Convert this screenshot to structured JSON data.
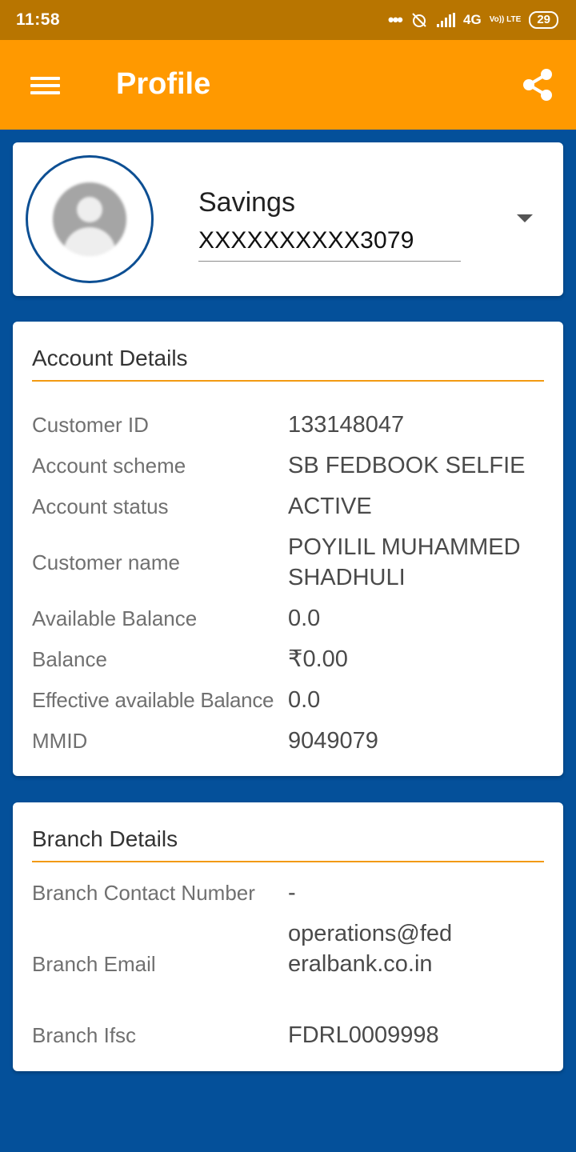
{
  "status_bar": {
    "time": "11:58",
    "network": "4G",
    "volte": "Vo)) LTE",
    "battery": "29"
  },
  "app_bar": {
    "title": "Profile",
    "menu_icon": "hamburger-menu-icon",
    "share_icon": "share-icon"
  },
  "account_selector": {
    "type": "Savings",
    "number": "XXXXXXXXXX3079"
  },
  "account_details": {
    "title": "Account Details",
    "rows": [
      {
        "label": "Customer ID",
        "value": "133148047"
      },
      {
        "label": "Account scheme",
        "value": "SB FEDBOOK SELFIE"
      },
      {
        "label": "Account status",
        "value": "ACTIVE"
      },
      {
        "label": "Customer name",
        "value": "POYILIL MUHAMMED SHADHULI"
      },
      {
        "label": "Available Balance",
        "value": "0.0"
      },
      {
        "label": "Balance",
        "value": "₹0.00"
      },
      {
        "label": "Effective available Balance",
        "value": "0.0"
      },
      {
        "label": "MMID",
        "value": "9049079"
      }
    ]
  },
  "branch_details": {
    "title": "Branch Details",
    "rows": [
      {
        "label": "Branch Contact Number",
        "value": "-"
      },
      {
        "label": "Branch Email",
        "value": "operations@federalbank.co.in"
      },
      {
        "label": "Branch Ifsc",
        "value": "FDRL0009998"
      }
    ]
  },
  "colors": {
    "status_bar": "#B87500",
    "app_bar": "#FF9900",
    "background": "#04509A",
    "accent_rule": "#F29A12"
  }
}
